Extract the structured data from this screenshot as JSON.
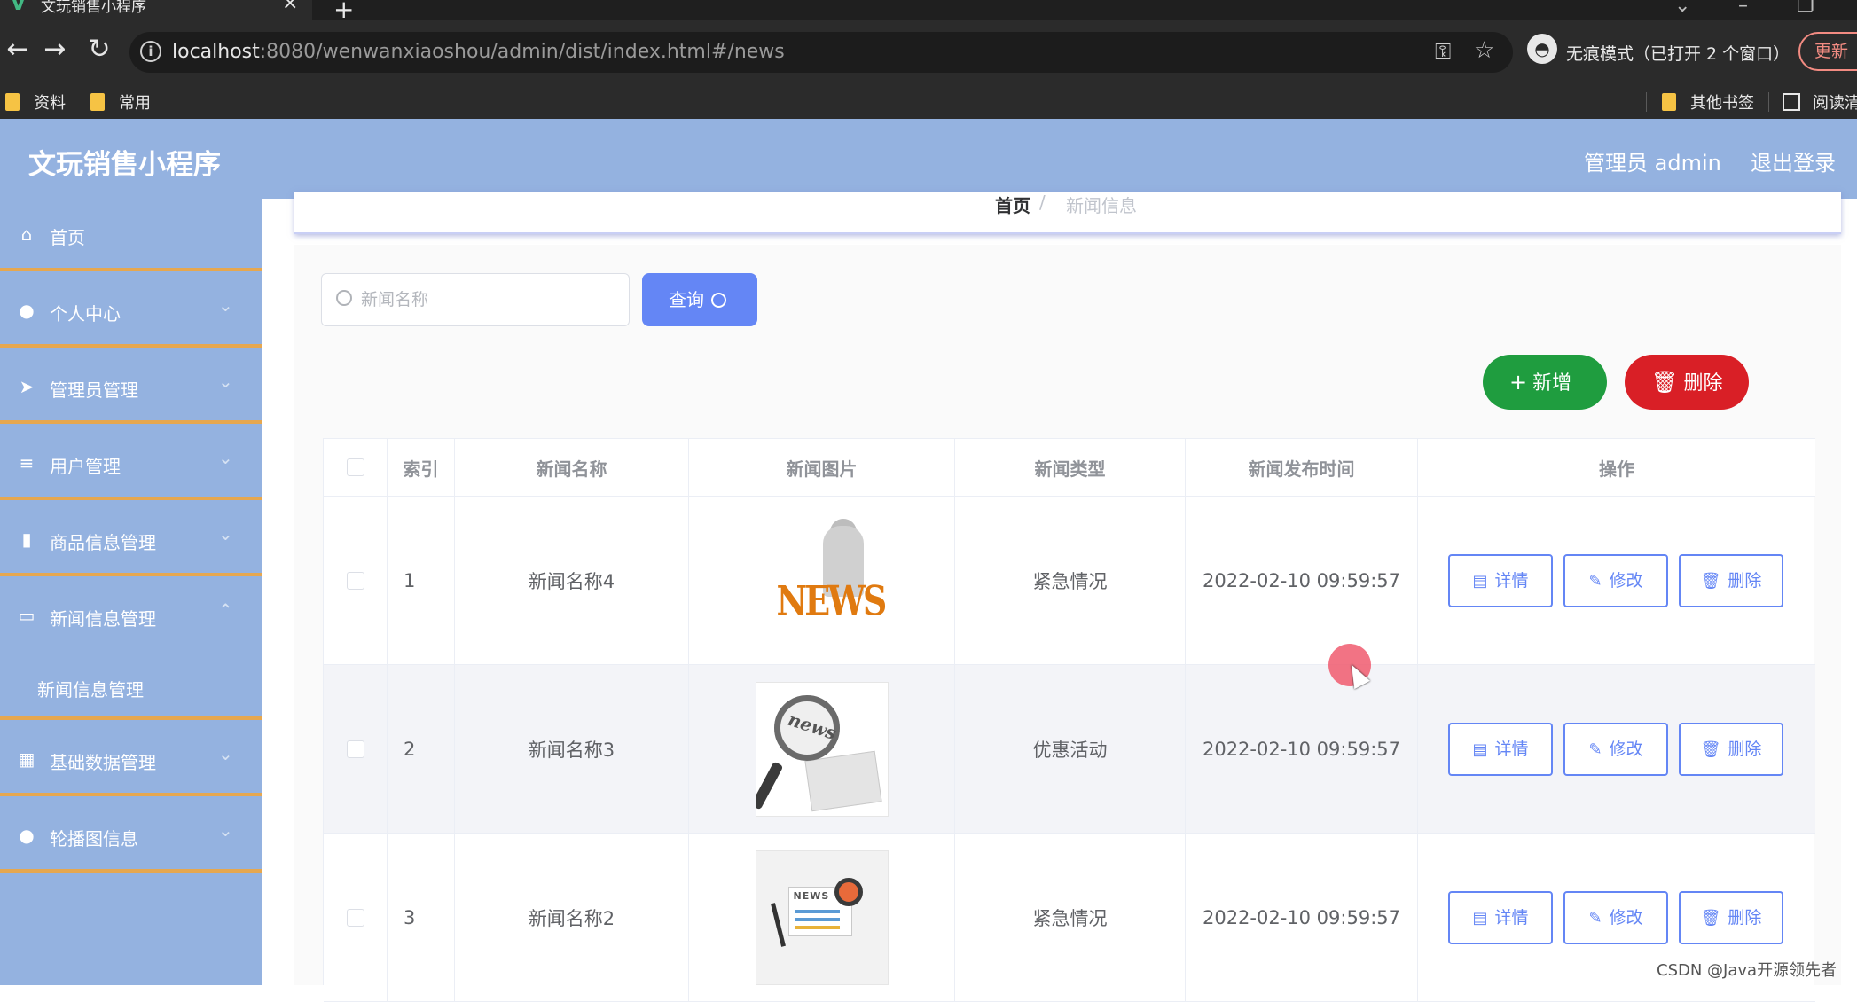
{
  "browser": {
    "tab_title": "文玩销售小程序",
    "tab_close": "×",
    "new_tab": "+",
    "url_host": "localhost",
    "url_rest": ":8080/wenwanxiaoshou/admin/dist/index.html#/news",
    "incognito_text": "无痕模式（已打开 2 个窗口）",
    "update_label": "更新",
    "bookmarks": [
      "资料",
      "常用"
    ],
    "other_bookmarks": "其他书签",
    "reading_list": "阅读清"
  },
  "header": {
    "app_title": "文玩销售小程序",
    "admin_label": "管理员 admin",
    "logout_label": "退出登录"
  },
  "sidebar": {
    "items": [
      {
        "label": "首页",
        "icon": "home-icon"
      },
      {
        "label": "个人中心",
        "icon": "user-icon"
      },
      {
        "label": "管理员管理",
        "icon": "send-icon"
      },
      {
        "label": "用户管理",
        "icon": "list-icon"
      },
      {
        "label": "商品信息管理",
        "icon": "chart-icon"
      },
      {
        "label": "新闻信息管理",
        "icon": "monitor-icon"
      },
      {
        "label": "基础数据管理",
        "icon": "grid-icon"
      },
      {
        "label": "轮播图信息",
        "icon": "user-icon"
      }
    ],
    "submenu": {
      "label": "新闻信息管理"
    }
  },
  "breadcrumb": {
    "home": "首页",
    "separator": "/",
    "current": "新闻信息"
  },
  "search": {
    "placeholder": "新闻名称",
    "value": "",
    "button_label": "查询"
  },
  "actions": {
    "add_label": "新增",
    "delete_label": "删除"
  },
  "table": {
    "columns": [
      "索引",
      "新闻名称",
      "新闻图片",
      "新闻类型",
      "新闻发布时间",
      "操作"
    ],
    "rows": [
      {
        "index": "1",
        "name": "新闻名称4",
        "type": "紧急情况",
        "time": "2022-02-10 09:59:57",
        "image": "news-figure-image"
      },
      {
        "index": "2",
        "name": "新闻名称3",
        "type": "优惠活动",
        "time": "2022-02-10 09:59:57",
        "image": "magnifier-newspaper-image"
      },
      {
        "index": "3",
        "name": "新闻名称2",
        "type": "紧急情况",
        "time": "2022-02-10 09:59:57",
        "image": "news-icons-image"
      }
    ],
    "row_actions": {
      "detail": "详情",
      "edit": "修改",
      "delete": "删除"
    }
  },
  "image_text": {
    "news_big": "NEWS",
    "news_lens": "news",
    "news_small": "NEWS"
  },
  "watermark": "CSDN @Java开源领先者",
  "colors": {
    "header_bg": "#94b2e0",
    "accent": "#6486f5",
    "add_green": "#1f9d3f",
    "delete_red": "#d91f26",
    "menu_border": "#e6a74f"
  }
}
